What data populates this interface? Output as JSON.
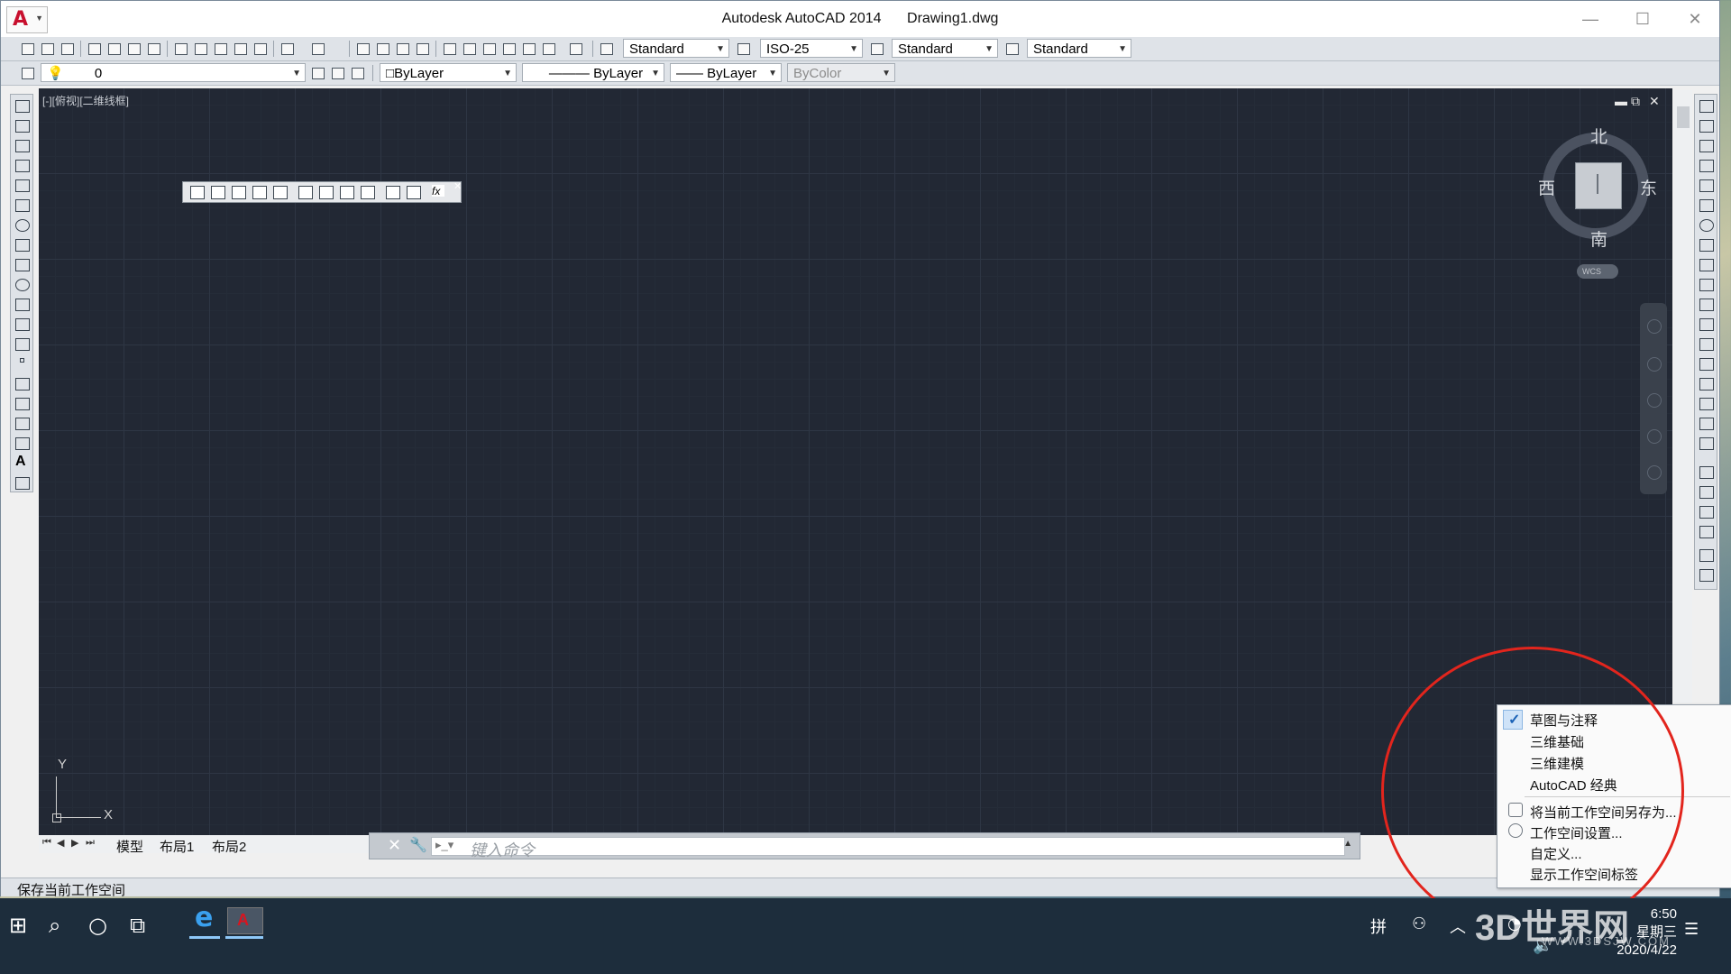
{
  "titlebar": {
    "app_name": "Autodesk AutoCAD 2014",
    "document": "Drawing1.dwg"
  },
  "toolbar": {
    "text_style": "Standard",
    "dim_style": "ISO-25",
    "table_style": "Standard",
    "multileader_style": "Standard"
  },
  "properties": {
    "layer": "0",
    "color": "ByLayer",
    "linetype": "ByLayer",
    "lineweight": "ByLayer",
    "plot_style": "ByColor"
  },
  "viewport": {
    "label": "[-][俯视][二维线框]"
  },
  "viewcube": {
    "north": "北",
    "south": "南",
    "east": "东",
    "west": "西",
    "wcs": "WCS"
  },
  "ucs": {
    "y": "Y",
    "x": "X"
  },
  "tabs": [
    "模型",
    "布局1",
    "布局2"
  ],
  "command": {
    "placeholder": "键入命令"
  },
  "status": "保存当前工作空间",
  "workspace_menu": {
    "checked": "草图与注释",
    "items": [
      "草图与注释",
      "三维基础",
      "三维建模",
      "AutoCAD 经典"
    ],
    "actions": [
      "将当前工作空间另存为...",
      "工作空间设置...",
      "自定义...",
      "显示工作空间标签"
    ]
  },
  "taskbar": {
    "time": "6:50",
    "weekday": "星期三",
    "date": "2020/4/22",
    "ime": "拼"
  },
  "watermark": {
    "main": "3D世界网",
    "sub": "WWW.3DSJW.COM"
  },
  "colors": {
    "canvas": "#222834",
    "highlight_circle": "#e2251d",
    "autocad_red": "#c8102e"
  }
}
